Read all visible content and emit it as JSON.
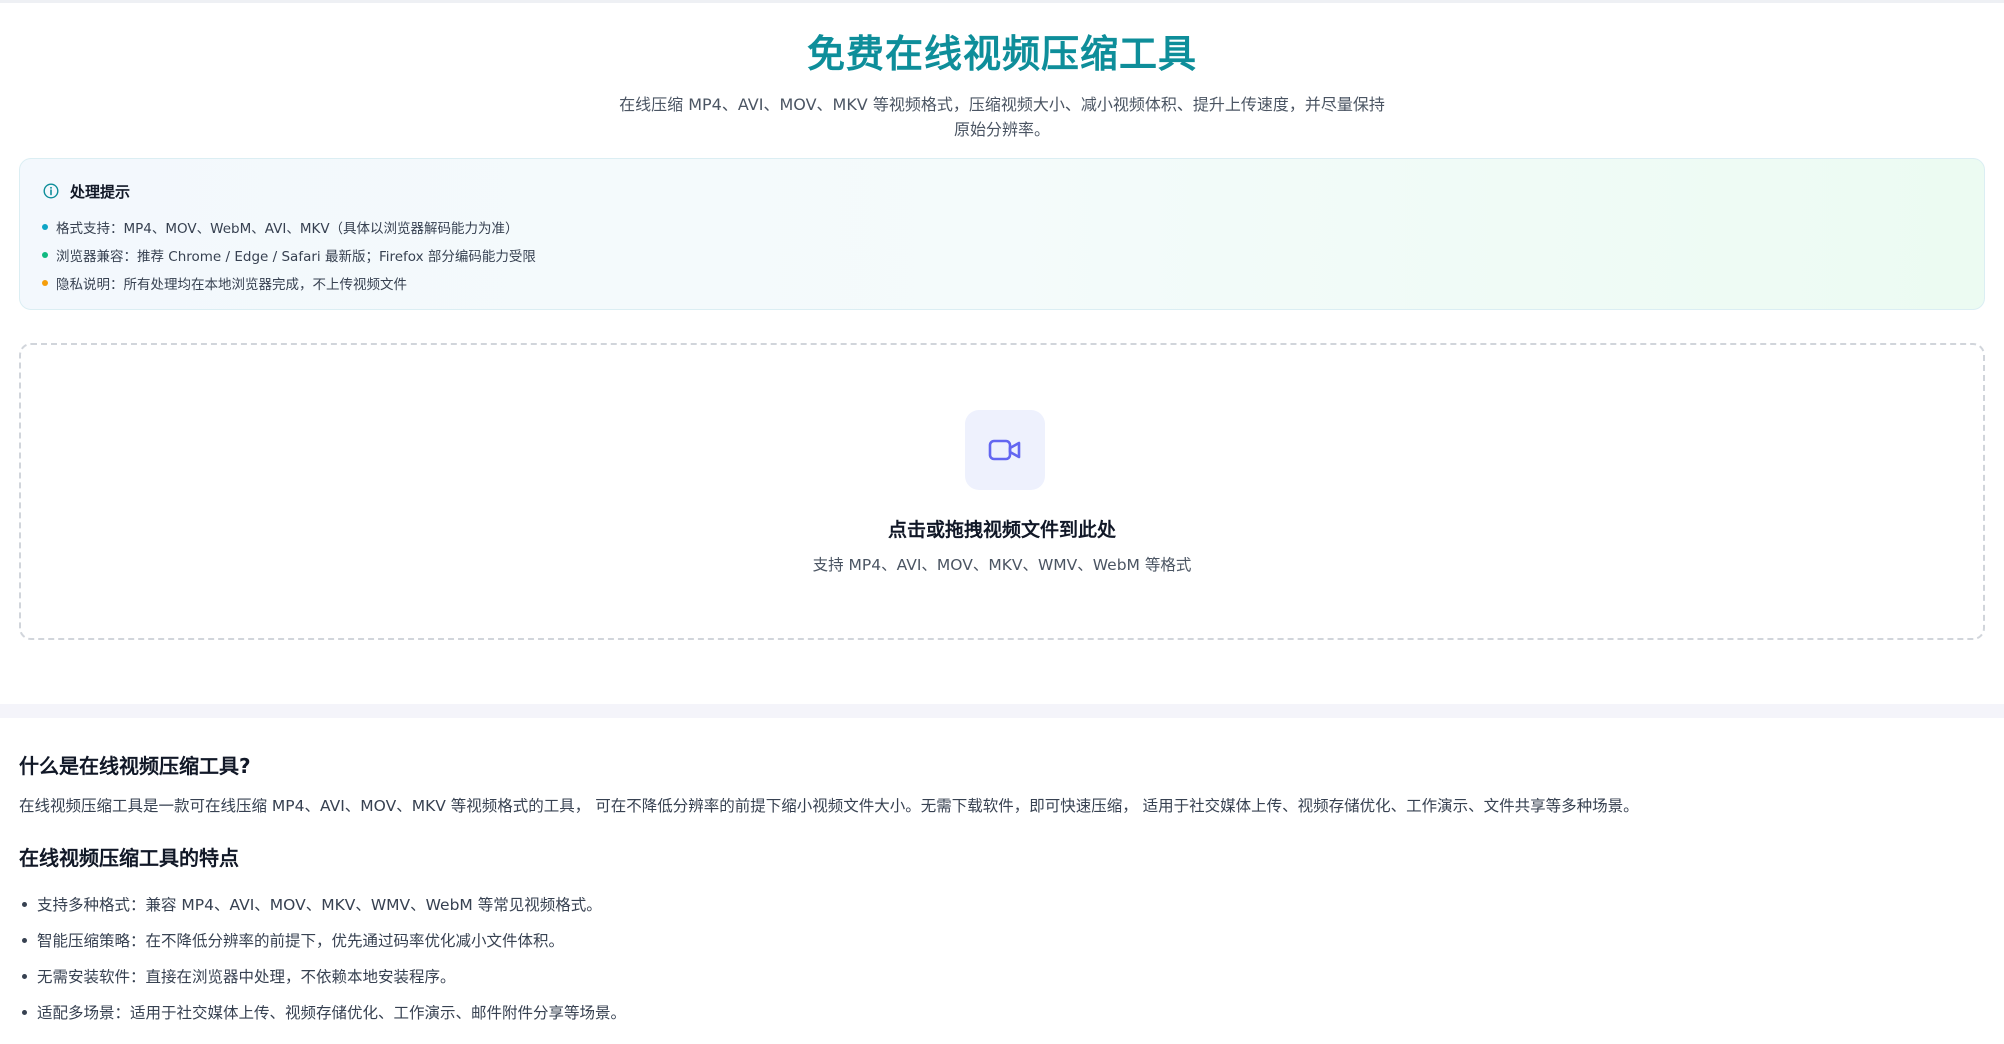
{
  "hero": {
    "title": "免费在线视频压缩工具",
    "subtitle": "在线压缩 MP4、AVI、MOV、MKV 等视频格式，压缩视频大小、减小视频体积、提升上传速度，并尽量保持原始分辨率。"
  },
  "tips": {
    "heading": "处理提示",
    "items": [
      {
        "text": "格式支持：MP4、MOV、WebM、AVI、MKV（具体以浏览器解码能力为准）",
        "color": "#0ea5c6"
      },
      {
        "text": "浏览器兼容：推荐 Chrome / Edge / Safari 最新版；Firefox 部分编码能力受限",
        "color": "#10b981"
      },
      {
        "text": "隐私说明：所有处理均在本地浏览器完成，不上传视频文件",
        "color": "#f59e0b"
      }
    ]
  },
  "upload": {
    "icon": "video-camera-icon",
    "title": "点击或拖拽视频文件到此处",
    "subtitle": "支持 MP4、AVI、MOV、MKV、WMV、WebM 等格式"
  },
  "about": {
    "heading": "什么是在线视频压缩工具?",
    "description": "在线视频压缩工具是一款可在线压缩 MP4、AVI、MOV、MKV 等视频格式的工具， 可在不降低分辨率的前提下缩小视频文件大小。无需下载软件，即可快速压缩， 适用于社交媒体上传、视频存储优化、工作演示、文件共享等多种场景。"
  },
  "features": {
    "heading": "在线视频压缩工具的特点",
    "items": [
      "支持多种格式：兼容 MP4、AVI、MOV、MKV、WMV、WebM 等常见视频格式。",
      "智能压缩策略：在不降低分辨率的前提下，优先通过码率优化减小文件体积。",
      "无需安装软件：直接在浏览器中处理，不依赖本地安装程序。",
      "适配多场景：适用于社交媒体上传、视频存储优化、工作演示、邮件附件分享等场景。"
    ]
  },
  "colors": {
    "accent": "#0e8e9a",
    "upload_icon": "#6366f1"
  }
}
